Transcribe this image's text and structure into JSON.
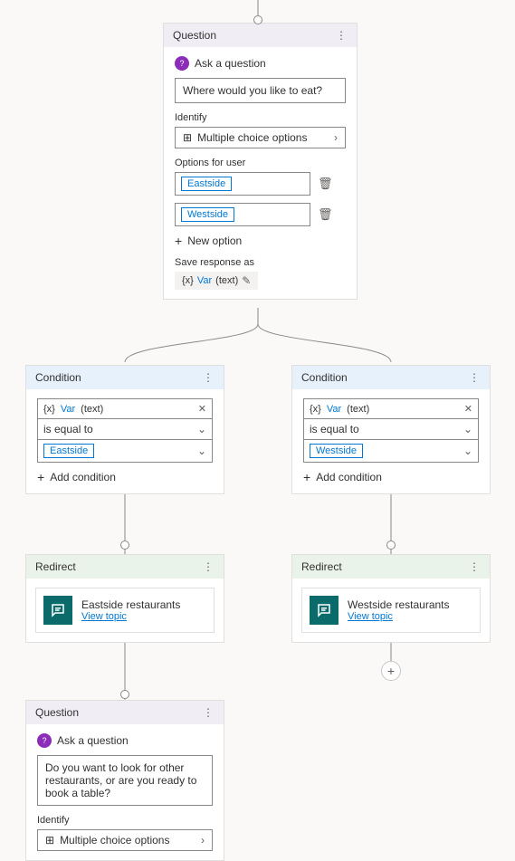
{
  "questionNode": {
    "header": "Question",
    "ask_label": "Ask a question",
    "prompt_text": "Where would you like to eat?",
    "identify_label": "Identify",
    "identify_value": "Multiple choice options",
    "options_label": "Options for user",
    "options": [
      "Eastside",
      "Westside"
    ],
    "new_option_label": "New option",
    "save_label": "Save response as",
    "var_prefix": "{x}",
    "var_name": "Var",
    "var_type": "(text)"
  },
  "conditions": [
    {
      "header": "Condition",
      "var_prefix": "{x}",
      "var_name": "Var",
      "var_type": "(text)",
      "operator": "is equal to",
      "value": "Eastside",
      "add_label": "Add condition"
    },
    {
      "header": "Condition",
      "var_prefix": "{x}",
      "var_name": "Var",
      "var_type": "(text)",
      "operator": "is equal to",
      "value": "Westside",
      "add_label": "Add condition"
    }
  ],
  "redirects": [
    {
      "header": "Redirect",
      "title": "Eastside restaurants",
      "view_label": "View topic"
    },
    {
      "header": "Redirect",
      "title": "Westside restaurants",
      "view_label": "View topic"
    }
  ],
  "questionNode2": {
    "header": "Question",
    "ask_label": "Ask a question",
    "prompt_text": "Do you want to look for other restaurants, or are you ready to book a table?",
    "identify_label": "Identify",
    "identify_value": "Multiple choice options"
  }
}
